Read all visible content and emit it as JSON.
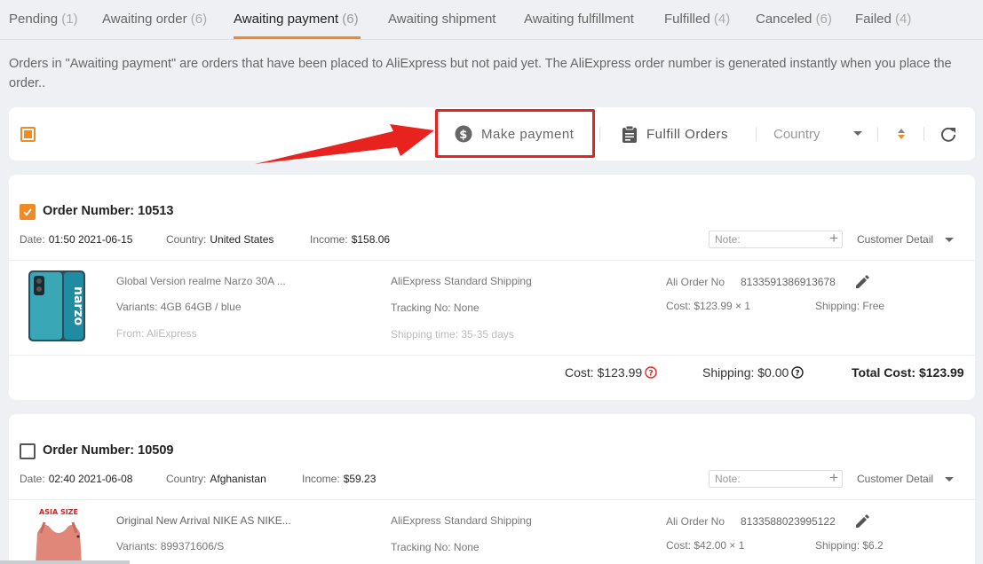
{
  "tabs": [
    {
      "label": "Pending",
      "count": "(1)"
    },
    {
      "label": "Awaiting order",
      "count": "(6)"
    },
    {
      "label": "Awaiting payment",
      "count": "(6)"
    },
    {
      "label": "Awaiting shipment",
      "count": ""
    },
    {
      "label": "Awaiting fulfillment",
      "count": ""
    },
    {
      "label": "Fulfilled",
      "count": "(4)"
    },
    {
      "label": "Canceled",
      "count": "(6)"
    },
    {
      "label": "Failed",
      "count": "(4)"
    }
  ],
  "active_tab": "Awaiting payment",
  "description": "Orders in \"Awaiting payment\" are orders that have been placed to AliExpress but not paid yet. The AliExpress order number is generated instantly when you place the order..",
  "toolbar": {
    "make_payment": "Make payment",
    "fulfill_orders": "Fulfill Orders",
    "country_placeholder": "Country",
    "select_all_state": "partial"
  },
  "labels": {
    "order_number": "Order Number:",
    "date": "Date:",
    "country": "Country:",
    "income": "Income:",
    "note_placeholder": "Note:",
    "customer_detail": "Customer Detail",
    "ali_order_no": "Ali Order No",
    "tracking": "Tracking No:",
    "shipping_time": "Shipping time:",
    "cost": "Cost:",
    "shipping": "Shipping:",
    "total_cost": "Total Cost:"
  },
  "orders": [
    {
      "checked": true,
      "number": "10513",
      "date": "01:50 2021-06-15",
      "country": "United States",
      "income": "$158.06",
      "product": {
        "title": "Global Version realme Narzo 30A ...",
        "variants": "Variants: 4GB 64GB / blue",
        "from": "From: AliExpress",
        "shipping_method": "AliExpress Standard Shipping",
        "tracking": "Tracking No: None",
        "shipping_time": "Shipping time: 35-35 days",
        "ali_order_no": "8133591386913678",
        "cost_line": "Cost: $123.99 × 1",
        "shipping_line": "Shipping: Free"
      },
      "totals": {
        "cost": "Cost: $123.99",
        "shipping": "Shipping: $0.00",
        "total": "Total Cost: $123.99"
      }
    },
    {
      "checked": false,
      "number": "10509",
      "date": "02:40 2021-06-08",
      "country": "Afghanistan",
      "income": "$59.23",
      "product": {
        "title": "Original New Arrival NIKE AS NIKE...",
        "variants": "Variants: 899371606/S",
        "shipping_method": "AliExpress Standard Shipping",
        "tracking": "Tracking No: None",
        "ali_order_no": "8133588023995122",
        "cost_line": "Cost: $42.00 × 1",
        "shipping_line": "Shipping: $6.2",
        "image_text": "ASIA SIZE"
      }
    }
  ],
  "colors": {
    "accent": "#f08a24",
    "highlight": "#e8231f",
    "background": "#eef0f3"
  }
}
